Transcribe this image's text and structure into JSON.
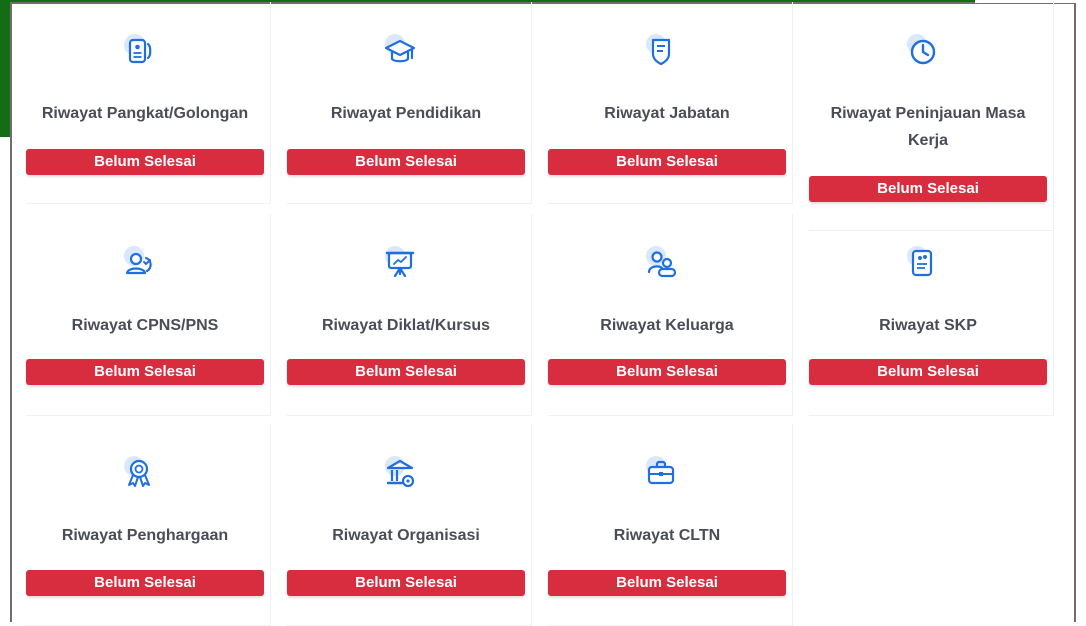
{
  "status_label": "Belum Selesai",
  "colors": {
    "badge": "#d72d3e",
    "icon_primary": "#1f6fe0",
    "icon_halo": "#dbe8fb",
    "title": "#4a4d57",
    "frame_accent": "#146c14"
  },
  "cards": [
    {
      "title": "Riwayat Pangkat/Golongan",
      "status": "Belum Selesai",
      "icon": "id-card-icon"
    },
    {
      "title": "Riwayat Pendidikan",
      "status": "Belum Selesai",
      "icon": "graduation-cap-icon"
    },
    {
      "title": "Riwayat Jabatan",
      "status": "Belum Selesai",
      "icon": "badge-shield-icon"
    },
    {
      "title": "Riwayat Peninjauan Masa Kerja",
      "status": "Belum Selesai",
      "icon": "clock-icon"
    },
    {
      "title": "Riwayat CPNS/PNS",
      "status": "Belum Selesai",
      "icon": "user-check-icon"
    },
    {
      "title": "Riwayat Diklat/Kursus",
      "status": "Belum Selesai",
      "icon": "presentation-board-icon"
    },
    {
      "title": "Riwayat Keluarga",
      "status": "Belum Selesai",
      "icon": "family-users-icon"
    },
    {
      "title": "Riwayat SKP",
      "status": "Belum Selesai",
      "icon": "document-report-icon"
    },
    {
      "title": "Riwayat Penghargaan",
      "status": "Belum Selesai",
      "icon": "award-medal-icon"
    },
    {
      "title": "Riwayat Organisasi",
      "status": "Belum Selesai",
      "icon": "organization-building-icon"
    },
    {
      "title": "Riwayat CLTN",
      "status": "Belum Selesai",
      "icon": "briefcase-icon"
    }
  ]
}
